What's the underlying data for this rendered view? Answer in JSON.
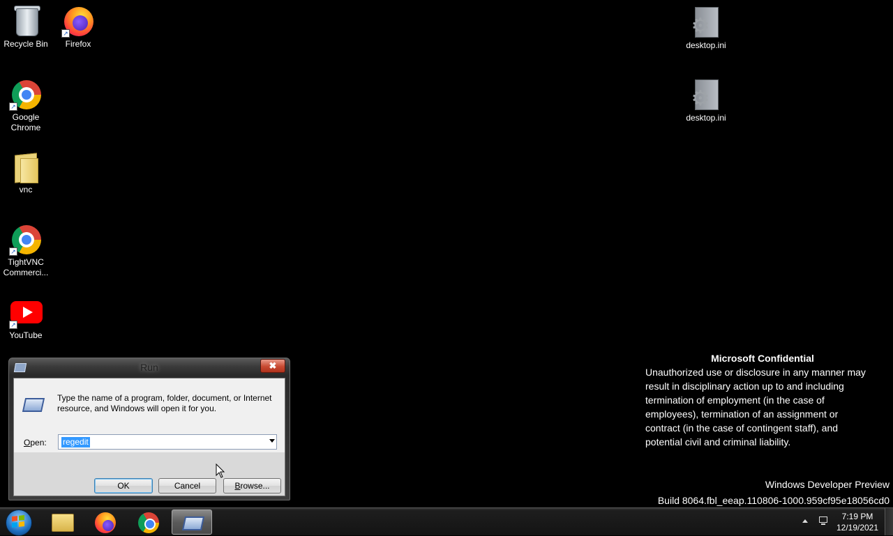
{
  "desktop": {
    "icons": [
      {
        "label": "Recycle Bin",
        "icon": "recycle-bin-icon"
      },
      {
        "label": "Firefox",
        "icon": "firefox-icon"
      },
      {
        "label": "Google Chrome",
        "icon": "chrome-icon"
      },
      {
        "label": "vnc",
        "icon": "folder-icon"
      },
      {
        "label": "TightVNC Commerci...",
        "icon": "chrome-icon"
      },
      {
        "label": "YouTube",
        "icon": "youtube-icon"
      },
      {
        "label": "desktop.ini",
        "icon": "settings-file-icon"
      },
      {
        "label": "desktop.ini",
        "icon": "settings-file-icon"
      }
    ]
  },
  "watermark": {
    "title": "Microsoft Confidential",
    "lines": [
      "Unauthorized use or disclosure in any manner may",
      "result in disciplinary action up to and including",
      "termination of employment (in the case of",
      "employees), termination of an assignment or",
      "contract (in the case of contingent staff), and",
      "potential civil and criminal liability."
    ],
    "edition": "Windows Developer Preview",
    "build": "Build 8064.fbl_eeap.110806-1000.959cf95e18056cd0"
  },
  "run_dialog": {
    "title": "Run",
    "close_glyph": "✖",
    "description": "Type the name of a program, folder, document, or Internet resource, and Windows will open it for you.",
    "open_label_prefix": "",
    "open_label_underlined": "O",
    "open_label_rest": "pen:",
    "input_value": "regedit",
    "ok_label": "OK",
    "cancel_label": "Cancel",
    "browse_label_underlined": "B",
    "browse_label_rest": "rowse..."
  },
  "taskbar": {
    "pinned": [
      {
        "name": "windows-explorer",
        "icon": "folder-icon"
      },
      {
        "name": "firefox",
        "icon": "firefox-icon"
      },
      {
        "name": "chrome",
        "icon": "chrome-icon"
      },
      {
        "name": "run",
        "icon": "run-icon",
        "active": true
      }
    ],
    "clock_time": "7:19 PM",
    "clock_date": "12/19/2021"
  },
  "colors": {
    "desktop_background": "#000000",
    "selection_highlight": "#3399ff",
    "close_button": "#c84a32"
  }
}
